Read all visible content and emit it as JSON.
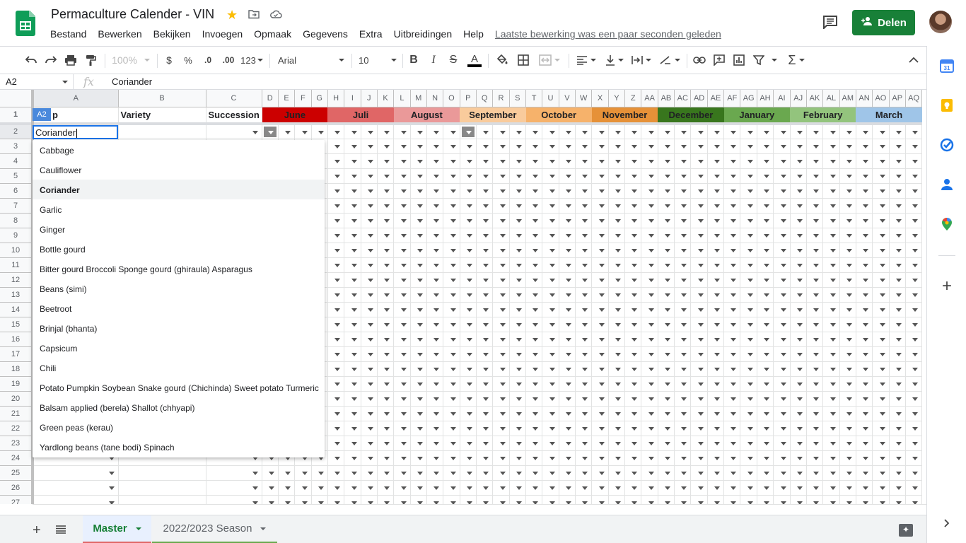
{
  "header": {
    "title": "Permaculture Calender - VIN",
    "menu": [
      "Bestand",
      "Bewerken",
      "Bekijken",
      "Invoegen",
      "Opmaak",
      "Gegevens",
      "Extra",
      "Uitbreidingen",
      "Help"
    ],
    "last_edit": "Laatste bewerking was een paar seconden geleden",
    "share_label": "Delen"
  },
  "toolbar": {
    "zoom": "100%",
    "currency": "$",
    "percent": "%",
    "dec_less": ".0",
    "dec_more": ".00",
    "format_more": "123",
    "font": "Arial",
    "font_size": "10"
  },
  "formula_bar": {
    "cell_ref": "A2",
    "fx": "fx",
    "value": "Coriander"
  },
  "columns": [
    "A",
    "B",
    "C",
    "D",
    "E",
    "F",
    "G",
    "H",
    "I",
    "J",
    "K",
    "L",
    "M",
    "N",
    "O",
    "P",
    "Q",
    "R",
    "S",
    "T",
    "U",
    "V",
    "W",
    "X",
    "Y",
    "Z",
    "AA",
    "AB",
    "AC",
    "AD",
    "AE",
    "AF",
    "AG",
    "AH",
    "AI",
    "AJ",
    "AK",
    "AL",
    "AM",
    "AN",
    "AO",
    "AP",
    "AQ"
  ],
  "row_numbers": [
    "1",
    "2",
    "3",
    "4",
    "5",
    "6",
    "7",
    "8",
    "9",
    "10",
    "11",
    "12",
    "13",
    "14",
    "15",
    "16",
    "17",
    "18",
    "19",
    "20",
    "21",
    "22",
    "23",
    "24",
    "25",
    "26",
    "27"
  ],
  "headers": {
    "crop": "p",
    "variety": "Variety",
    "succession": "Succession"
  },
  "months": [
    {
      "name": "June",
      "color": "#cc0000"
    },
    {
      "name": "Juli",
      "color": "#e06666"
    },
    {
      "name": "August",
      "color": "#ea9999"
    },
    {
      "name": "September",
      "color": "#f9cb9c"
    },
    {
      "name": "October",
      "color": "#f6b26b"
    },
    {
      "name": "November",
      "color": "#e69138"
    },
    {
      "name": "December",
      "color": "#38761d"
    },
    {
      "name": "January",
      "color": "#6aa84f"
    },
    {
      "name": "February",
      "color": "#93c47d"
    },
    {
      "name": "March",
      "color": "#9fc5e8"
    }
  ],
  "selected_cell": {
    "ref": "A2",
    "value": "Coriander"
  },
  "dropdown_options": [
    "Cabbage",
    "Cauliflower",
    "Coriander",
    "Garlic",
    "Ginger",
    "Bottle gourd",
    "Bitter gourd Broccoli Sponge gourd (ghiraula) Asparagus",
    "Beans (simi)",
    "Beetroot",
    "Brinjal (bhanta)",
    "Capsicum",
    "Chili",
    "Potato Pumpkin Soybean Snake gourd (Chichinda) Sweet potato Turmeric",
    "Balsam applied (berela) Shallot (chhyapi)",
    "Green peas (kerau)",
    "Yardlong beans (tane bodi) Spinach"
  ],
  "dropdown_active": "Coriander",
  "sheet_tabs": [
    {
      "label": "Master",
      "color": "#e06666",
      "active": true
    },
    {
      "label": "2022/2023 Season",
      "color": "#6aa84f",
      "active": false
    }
  ]
}
